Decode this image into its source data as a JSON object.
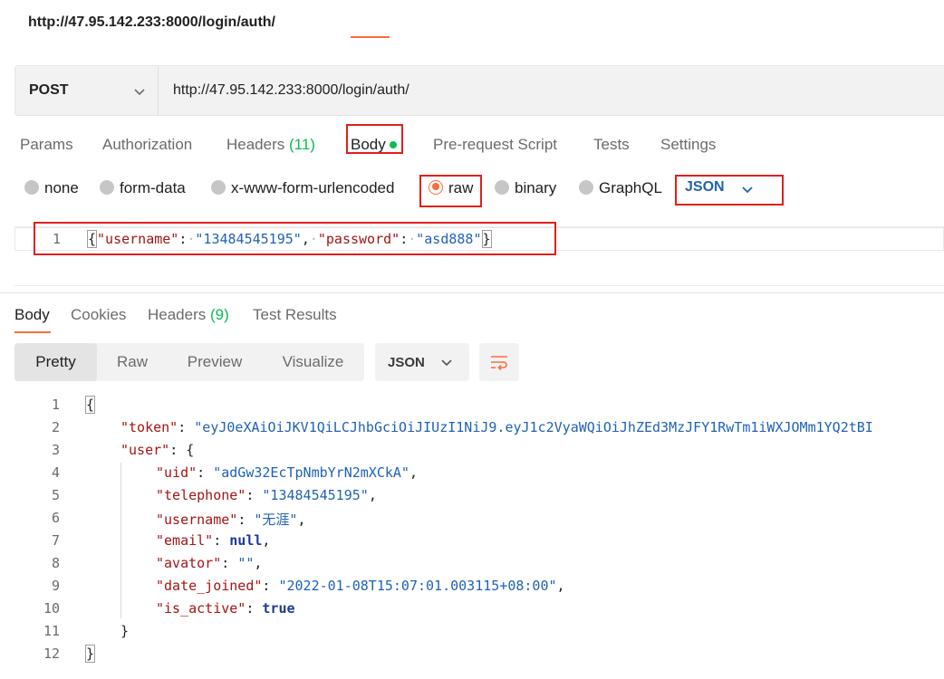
{
  "title": "http://47.95.142.233:8000/login/auth/",
  "request": {
    "method": "POST",
    "url": "http://47.95.142.233:8000/login/auth/"
  },
  "request_tabs": {
    "params": "Params",
    "authorization": "Authorization",
    "headers_label": "Headers",
    "headers_count": "(11)",
    "body": "Body",
    "prerequest": "Pre-request Script",
    "tests": "Tests",
    "settings": "Settings"
  },
  "body_types": {
    "none": "none",
    "form_data": "form-data",
    "urlencoded": "x-www-form-urlencoded",
    "raw": "raw",
    "binary": "binary",
    "graphql": "GraphQL",
    "format": "JSON"
  },
  "request_body": {
    "line_number": "1",
    "open_brace": "{",
    "key1": "\"username\"",
    "val1": "\"13484545195\"",
    "key2": "\"password\"",
    "val2": "\"asd888\"",
    "close_brace": "}"
  },
  "response_tabs": {
    "body": "Body",
    "cookies": "Cookies",
    "headers_label": "Headers",
    "headers_count": "(9)",
    "test_results": "Test Results"
  },
  "response_view": {
    "pretty": "Pretty",
    "raw": "Raw",
    "preview": "Preview",
    "visualize": "Visualize",
    "format": "JSON"
  },
  "response_body": {
    "line_numbers": [
      "1",
      "2",
      "3",
      "4",
      "5",
      "6",
      "7",
      "8",
      "9",
      "10",
      "11",
      "12"
    ],
    "token_key": "\"token\"",
    "token_val": "\"eyJ0eXAiOiJKV1QiLCJhbGciOiJIUzI1NiJ9.eyJ1c2VyaWQiOiJhZEd3MzJFY1RwTm1iWXJOMm1YQ2tBI",
    "user_key": "\"user\"",
    "uid_key": "\"uid\"",
    "uid_val": "\"adGw32EcTpNmbYrN2mXCkA\"",
    "telephone_key": "\"telephone\"",
    "telephone_val": "\"13484545195\"",
    "username_key": "\"username\"",
    "username_val": "\"无涯\"",
    "email_key": "\"email\"",
    "email_val": "null",
    "avator_key": "\"avator\"",
    "avator_val": "\"\"",
    "date_joined_key": "\"date_joined\"",
    "date_joined_val": "\"2022-01-08T15:07:01.003115+08:00\"",
    "is_active_key": "\"is_active\"",
    "is_active_val": "true"
  },
  "colors": {
    "accent": "#ff6c37",
    "highlight_box": "#e0201e",
    "count_green": "#0cbb52",
    "json_key": "#a31515",
    "json_string": "#1f62b5"
  }
}
